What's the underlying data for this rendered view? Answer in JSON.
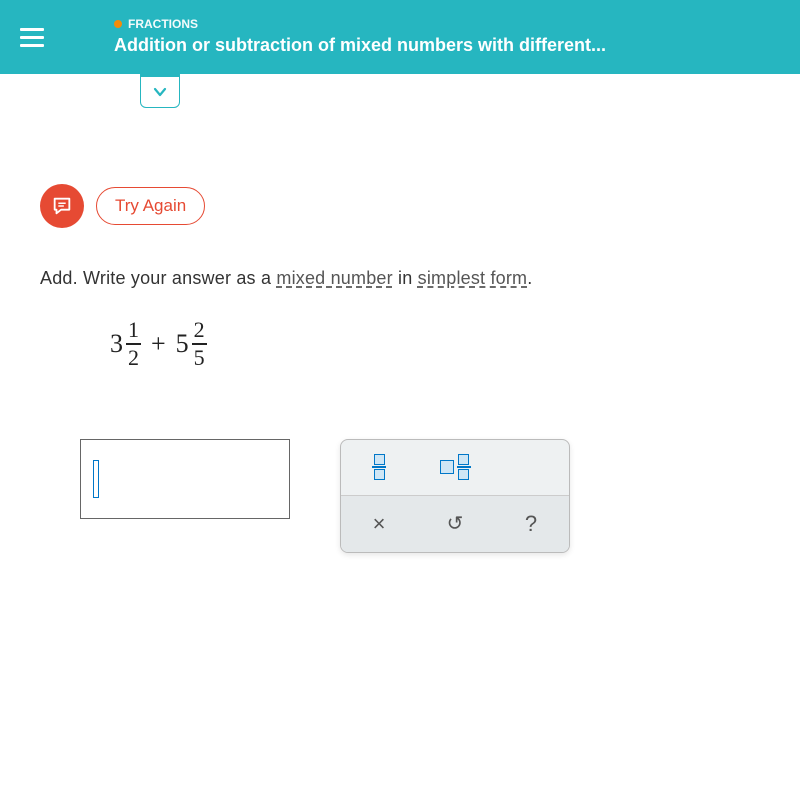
{
  "header": {
    "unit_label": "FRACTIONS",
    "lesson_title": "Addition or subtraction of mixed numbers with different..."
  },
  "feedback": {
    "label": "Try Again"
  },
  "instruction": {
    "prefix": "Add. Write your answer as a ",
    "term1": "mixed number",
    "middle": " in ",
    "term2": "simplest form",
    "suffix": "."
  },
  "expression": {
    "operand1_whole": "3",
    "operand1_num": "1",
    "operand1_den": "2",
    "operator": "+",
    "operand2_whole": "5",
    "operand2_num": "2",
    "operand2_den": "5"
  },
  "toolbox": {
    "clear_symbol": "×",
    "undo_symbol": "↺",
    "help_symbol": "?"
  }
}
